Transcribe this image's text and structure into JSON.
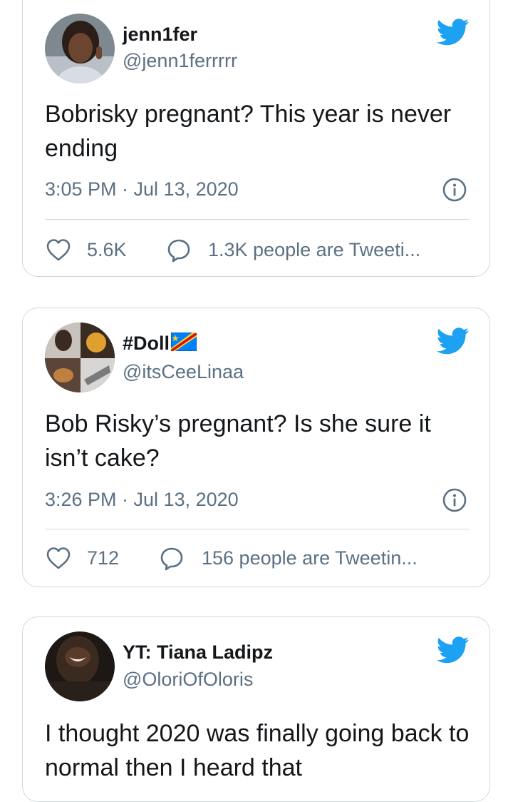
{
  "tweets": [
    {
      "display_name": "jenn1fer",
      "handle": "@jenn1ferrrrr",
      "text": "Bobrisky pregnant? This year is never ending",
      "timestamp": "3:05 PM · Jul 13, 2020",
      "likes": "5.6K",
      "tweeting": "1.3K people are Tweeti..."
    },
    {
      "display_name": "#Doll",
      "display_name_emoji": "DR Congo flag",
      "handle": "@itsCeeLinaa",
      "text": "Bob Risky’s pregnant? Is she sure it isn’t cake?",
      "timestamp": "3:26 PM · Jul 13, 2020",
      "likes": "712",
      "tweeting": "156 people are Tweetin..."
    },
    {
      "display_name": "YT: Tiana Ladipz",
      "handle": "@OloriOfOloris",
      "text": "I thought 2020 was finally going back to normal then I heard that"
    }
  ],
  "icons": {
    "brand": "twitter-bird-icon",
    "info": "info-icon",
    "like": "heart-icon",
    "reply": "speech-bubble-icon"
  },
  "colors": {
    "twitter_blue": "#1da1f2",
    "secondary_text": "#5b7083",
    "border": "#cfd9de"
  }
}
